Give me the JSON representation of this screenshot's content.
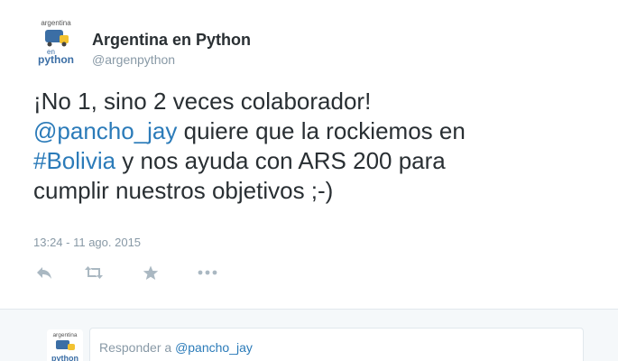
{
  "tweet": {
    "author_name": "Argentina en Python",
    "author_handle": "@argenpython",
    "logo_text_top": "argentina",
    "logo_text_en": "en",
    "logo_text_python": "python",
    "text_line1": "¡No 1, sino 2 veces colaborador!",
    "mention": "@pancho_jay",
    "text_line2_rest": " quiere que la rockiemos en",
    "hashtag": "#Bolivia",
    "text_line3_rest": " y nos ayuda con ARS 200 para",
    "text_line4": "cumplir nuestros objetivos ;-)",
    "timestamp": "13:24 - 11 ago. 2015"
  },
  "actions": [
    {
      "name": "reply-icon"
    },
    {
      "name": "retweet-icon"
    },
    {
      "name": "favorite-icon"
    },
    {
      "name": "more-icon"
    }
  ],
  "reply": {
    "placeholder_prefix": "Responder a ",
    "placeholder_mention": "@pancho_jay"
  },
  "colors": {
    "link": "#2b7bb9",
    "muted": "#8899a6",
    "text": "#292f33",
    "reply_bg": "#f5f8fa",
    "action_icon": "#aab8c2"
  }
}
